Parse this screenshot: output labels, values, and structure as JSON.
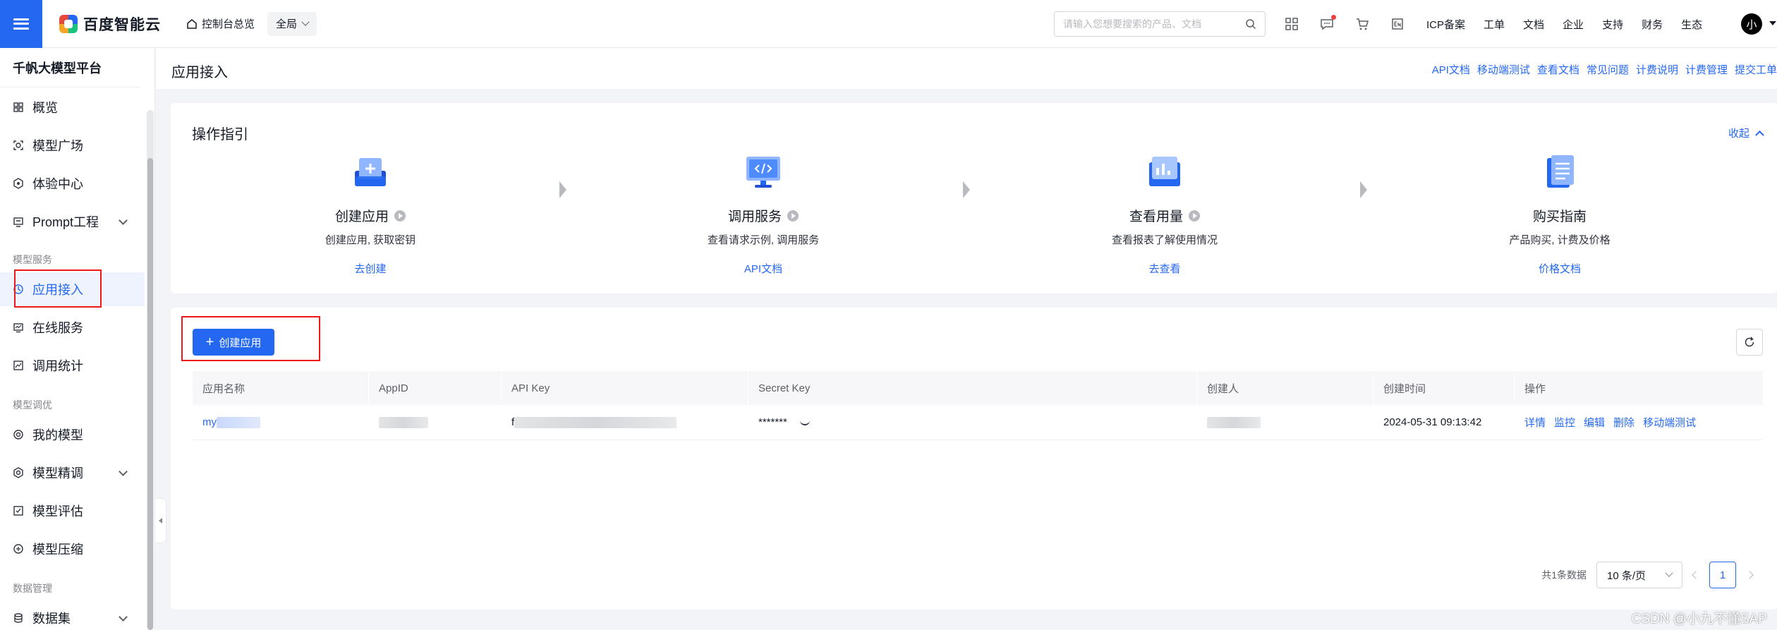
{
  "topbar": {
    "brand": "百度智能云",
    "overview": "控制台总览",
    "region": "全局",
    "search_placeholder": "请输入您想要搜索的产品、文档",
    "links": [
      "ICP备案",
      "工单",
      "文档",
      "企业",
      "支持",
      "财务",
      "生态"
    ],
    "avatar": "小"
  },
  "sidebar": {
    "title": "千帆大模型平台",
    "items": [
      {
        "label": "概览",
        "icon": "grid-icon"
      },
      {
        "label": "模型广场",
        "icon": "model-square-icon"
      },
      {
        "label": "体验中心",
        "icon": "experience-icon"
      },
      {
        "label": "Prompt工程",
        "icon": "prompt-icon"
      },
      {
        "label": "应用接入",
        "icon": "app-access-icon"
      },
      {
        "label": "在线服务",
        "icon": "online-service-icon"
      },
      {
        "label": "调用统计",
        "icon": "stats-icon"
      },
      {
        "label": "我的模型",
        "icon": "my-model-icon"
      },
      {
        "label": "模型精调",
        "icon": "fine-tune-icon"
      },
      {
        "label": "模型评估",
        "icon": "evaluate-icon"
      },
      {
        "label": "模型压缩",
        "icon": "compress-icon"
      },
      {
        "label": "数据集",
        "icon": "dataset-icon"
      }
    ],
    "groups": [
      "模型服务",
      "模型调优",
      "数据管理"
    ]
  },
  "page": {
    "title": "应用接入",
    "header_links": [
      "API文档",
      "移动端测试",
      "查看文档",
      "常见问题",
      "计费说明",
      "计费管理",
      "提交工单"
    ]
  },
  "guide": {
    "title": "操作指引",
    "collapse_label": "收起",
    "steps": [
      {
        "name": "创建应用",
        "desc": "创建应用, 获取密钥",
        "link": "去创建",
        "icon": "create-app-icon"
      },
      {
        "name": "调用服务",
        "desc": "查看请求示例, 调用服务",
        "link": "API文档",
        "icon": "call-service-icon"
      },
      {
        "name": "查看用量",
        "desc": "查看报表了解使用情况",
        "link": "去查看",
        "icon": "usage-icon"
      },
      {
        "name": "购买指南",
        "desc": "产品购买, 计费及价格",
        "link": "价格文档",
        "icon": "purchase-guide-icon"
      }
    ]
  },
  "table": {
    "create_label": "创建应用",
    "columns": [
      "应用名称",
      "AppID",
      "API Key",
      "Secret Key",
      "创建人",
      "创建时间",
      "操作"
    ],
    "rows": [
      {
        "name": "my",
        "api_key_prefix": "f",
        "secret": "*******",
        "created": "2024-05-31 09:13:42",
        "actions": [
          "详情",
          "监控",
          "编辑",
          "删除",
          "移动端测试"
        ]
      }
    ]
  },
  "pager": {
    "total": "共1条数据",
    "page_size": "10 条/页",
    "current": "1"
  },
  "watermark": "CSDN @小九不懂SAP",
  "colors": {
    "accent": "#2468f2",
    "highlight_box": "#f01818"
  }
}
